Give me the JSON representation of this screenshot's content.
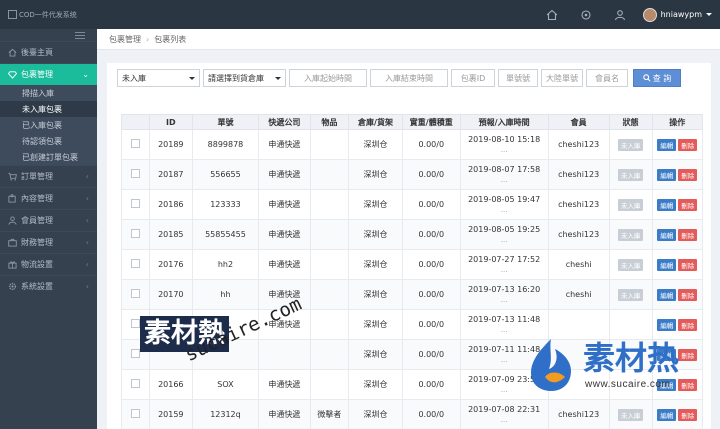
{
  "app": {
    "logo_alt": "COD一件代发系统",
    "username": "hniawypm"
  },
  "sidebar": {
    "items": [
      {
        "label": "後臺主頁",
        "icon": "home-icon",
        "active": false,
        "has_children": false
      },
      {
        "label": "包裹管理",
        "icon": "diamond-icon",
        "active": true,
        "has_children": true
      },
      {
        "label": "訂單管理",
        "icon": "cart-icon",
        "active": false,
        "has_children": true
      },
      {
        "label": "內容管理",
        "icon": "puzzle-icon",
        "active": false,
        "has_children": true
      },
      {
        "label": "會員管理",
        "icon": "user-icon",
        "active": false,
        "has_children": true
      },
      {
        "label": "財務管理",
        "icon": "briefcase-icon",
        "active": false,
        "has_children": true
      },
      {
        "label": "物流設置",
        "icon": "gift-icon",
        "active": false,
        "has_children": true
      },
      {
        "label": "系統設置",
        "icon": "gear-icon",
        "active": false,
        "has_children": true
      }
    ],
    "sub_items": [
      {
        "label": "掃描入庫",
        "selected": false
      },
      {
        "label": "未入庫包裹",
        "selected": true
      },
      {
        "label": "已入庫包裹",
        "selected": false
      },
      {
        "label": "待認領包裹",
        "selected": false
      },
      {
        "label": "已創建訂單包裹",
        "selected": false
      }
    ]
  },
  "breadcrumb": {
    "items": [
      "包裹管理",
      "包裹列表"
    ],
    "separator": "›"
  },
  "filters": {
    "status_select": "未入庫",
    "warehouse_select": "請選擇到貨倉庫",
    "date_start_placeholder": "入庫起始時間",
    "date_end_placeholder": "入庫結束時間",
    "package_id_placeholder": "包裹ID",
    "tracking_placeholder": "單號號",
    "land_tracking_placeholder": "大陸單號",
    "member_placeholder": "會員名",
    "search_label": "查 詢"
  },
  "table": {
    "headers": [
      "",
      "ID",
      "單號",
      "快遞公司",
      "物品",
      "倉庫/貨架",
      "實重/體積重",
      "預報/入庫時間",
      "會員",
      "狀態",
      "操作"
    ],
    "rows": [
      {
        "id": "20189",
        "tracking": "8899878",
        "courier": "申通快遞",
        "item": "",
        "warehouse": "深圳仓",
        "weight": "0.00/0",
        "time": "2019-08-10 15:18",
        "time2": "...",
        "member": "cheshi123",
        "status": "未入庫"
      },
      {
        "id": "20187",
        "tracking": "556655",
        "courier": "申通快遞",
        "item": "",
        "warehouse": "深圳仓",
        "weight": "0.00/0",
        "time": "2019-08-07 17:58",
        "time2": "...",
        "member": "cheshi123",
        "status": "未入庫"
      },
      {
        "id": "20186",
        "tracking": "123333",
        "courier": "申通快遞",
        "item": "",
        "warehouse": "深圳仓",
        "weight": "0.00/0",
        "time": "2019-08-05 19:47",
        "time2": "...",
        "member": "cheshi123",
        "status": "未入庫"
      },
      {
        "id": "20185",
        "tracking": "55855455",
        "courier": "申通快遞",
        "item": "",
        "warehouse": "深圳仓",
        "weight": "0.00/0",
        "time": "2019-08-05 19:25",
        "time2": "...",
        "member": "cheshi123",
        "status": "未入庫"
      },
      {
        "id": "20176",
        "tracking": "hh2",
        "courier": "申通快遞",
        "item": "",
        "warehouse": "深圳仓",
        "weight": "0.00/0",
        "time": "2019-07-27 17:52",
        "time2": "...",
        "member": "cheshi",
        "status": "未入庫"
      },
      {
        "id": "20170",
        "tracking": "hh",
        "courier": "申通快遞",
        "item": "",
        "warehouse": "深圳仓",
        "weight": "0.00/0",
        "time": "2019-07-13 16:20",
        "time2": "...",
        "member": "cheshi",
        "status": "未入庫"
      },
      {
        "id": "",
        "tracking": "cc",
        "courier": "申通快遞",
        "item": "",
        "warehouse": "深圳仓",
        "weight": "0.00/0",
        "time": "2019-07-13 11:48",
        "time2": "...",
        "member": "",
        "status": ""
      },
      {
        "id": "",
        "tracking": "",
        "courier": "",
        "item": "",
        "warehouse": "深圳仓",
        "weight": "0.00/0",
        "time": "2019-07-11 11:48",
        "time2": "...",
        "member": "",
        "status": ""
      },
      {
        "id": "20166",
        "tracking": "SOX",
        "courier": "申通快遞",
        "item": "",
        "warehouse": "深圳仓",
        "weight": "0.00/0",
        "time": "2019-07-09 23:50",
        "time2": "...",
        "member": "",
        "status": ""
      },
      {
        "id": "20159",
        "tracking": "12312q",
        "courier": "申通快遞",
        "item": "微擊者",
        "warehouse": "深圳仓",
        "weight": "0.00/0",
        "time": "2019-07-08 22:31",
        "time2": "...",
        "member": "cheshi123",
        "status": "未入庫"
      }
    ],
    "edit_label": "編輯",
    "delete_label": "刪除"
  },
  "watermark": {
    "left_logo": "素材熱",
    "left_url": "sucaire.com",
    "right_logo": "素材热",
    "right_url": "www.sucaire.com"
  }
}
